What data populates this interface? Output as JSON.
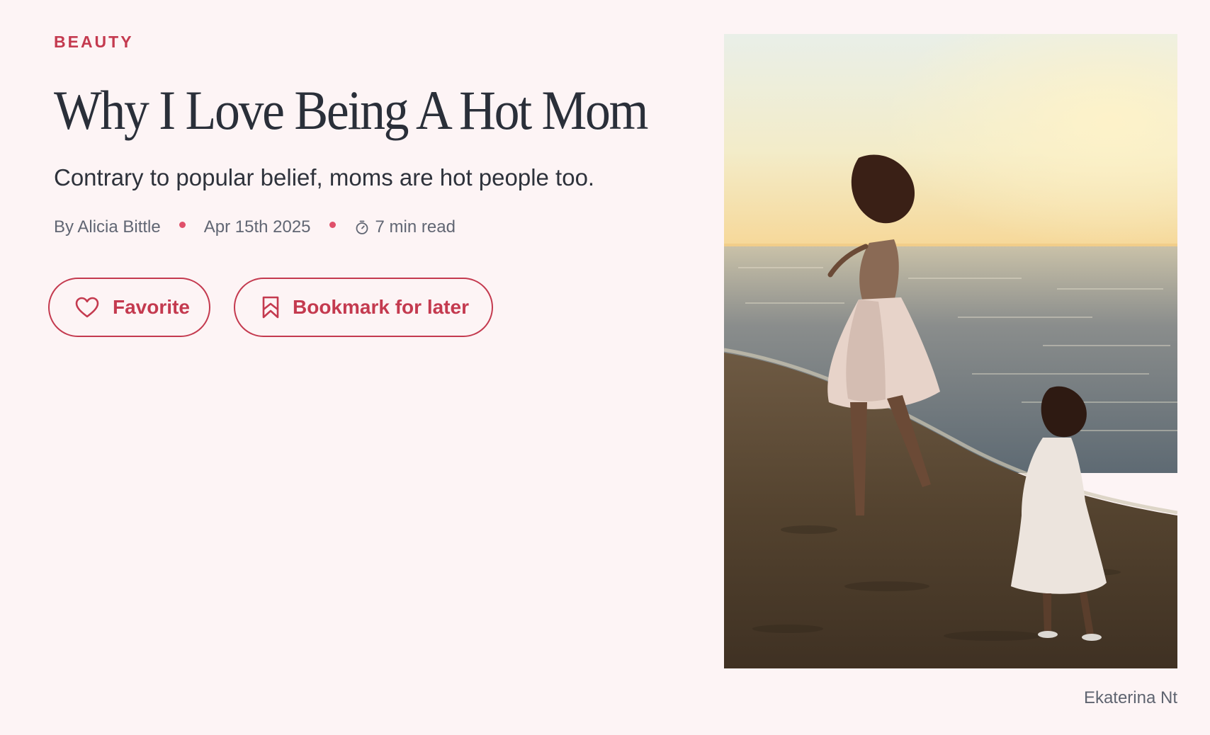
{
  "article": {
    "category": "BEAUTY",
    "title": "Why I Love Being A Hot Mom",
    "subtitle": "Contrary to popular belief, moms are hot people too.",
    "author": "By Alicia Bittle",
    "date": "Apr 15th 2025",
    "read_time": "7 min read"
  },
  "actions": {
    "favorite_label": "Favorite",
    "bookmark_label": "Bookmark for later"
  },
  "image": {
    "credit": "Ekaterina Nt"
  },
  "icons": {
    "favorite": "heart-icon",
    "bookmark": "bookmark-icon",
    "read_time": "timer-icon"
  },
  "colors": {
    "background": "#fdf4f5",
    "accent": "#c43a4f",
    "dot": "#e0506a",
    "title": "#2a2f39",
    "meta": "#616673"
  }
}
